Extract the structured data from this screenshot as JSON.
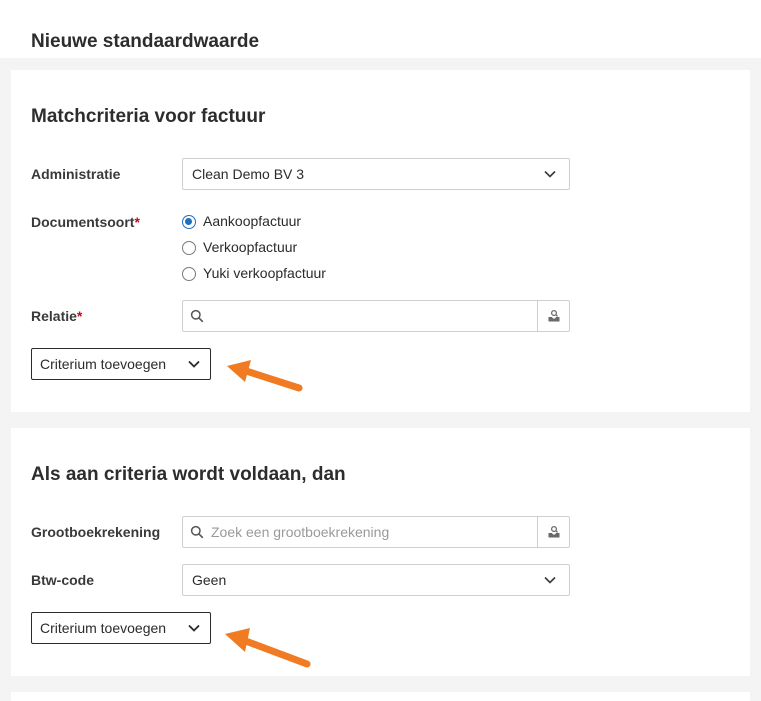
{
  "page": {
    "title": "Nieuwe standaardwaarde"
  },
  "match_section": {
    "title": "Matchcriteria voor factuur",
    "administratie": {
      "label": "Administratie",
      "value": "Clean Demo BV 3"
    },
    "documentsoort": {
      "label": "Documentsoort",
      "required_mark": "*",
      "options": [
        {
          "label": "Aankoopfactuur",
          "checked": true
        },
        {
          "label": "Verkoopfactuur",
          "checked": false
        },
        {
          "label": "Yuki verkoopfactuur",
          "checked": false
        }
      ]
    },
    "relatie": {
      "label": "Relatie",
      "required_mark": "*",
      "value": ""
    },
    "add_button": {
      "label": "Criterium toevoegen"
    }
  },
  "action_section": {
    "title": "Als aan criteria wordt voldaan, dan",
    "grootboekrekening": {
      "label": "Grootboekrekening",
      "placeholder": "Zoek een grootboekrekening"
    },
    "btw_code": {
      "label": "Btw-code",
      "value": "Geen"
    },
    "add_button": {
      "label": "Criterium toevoegen"
    }
  },
  "colors": {
    "accent_radio": "#1f6fbf",
    "required_mark": "#d0021b",
    "annotation_arrow": "#f07b22"
  },
  "icons": {
    "select_chevron": "chevron-down-icon",
    "search": "search-icon",
    "lookup": "lookup-icon",
    "annotation": "arrow-annotation"
  }
}
